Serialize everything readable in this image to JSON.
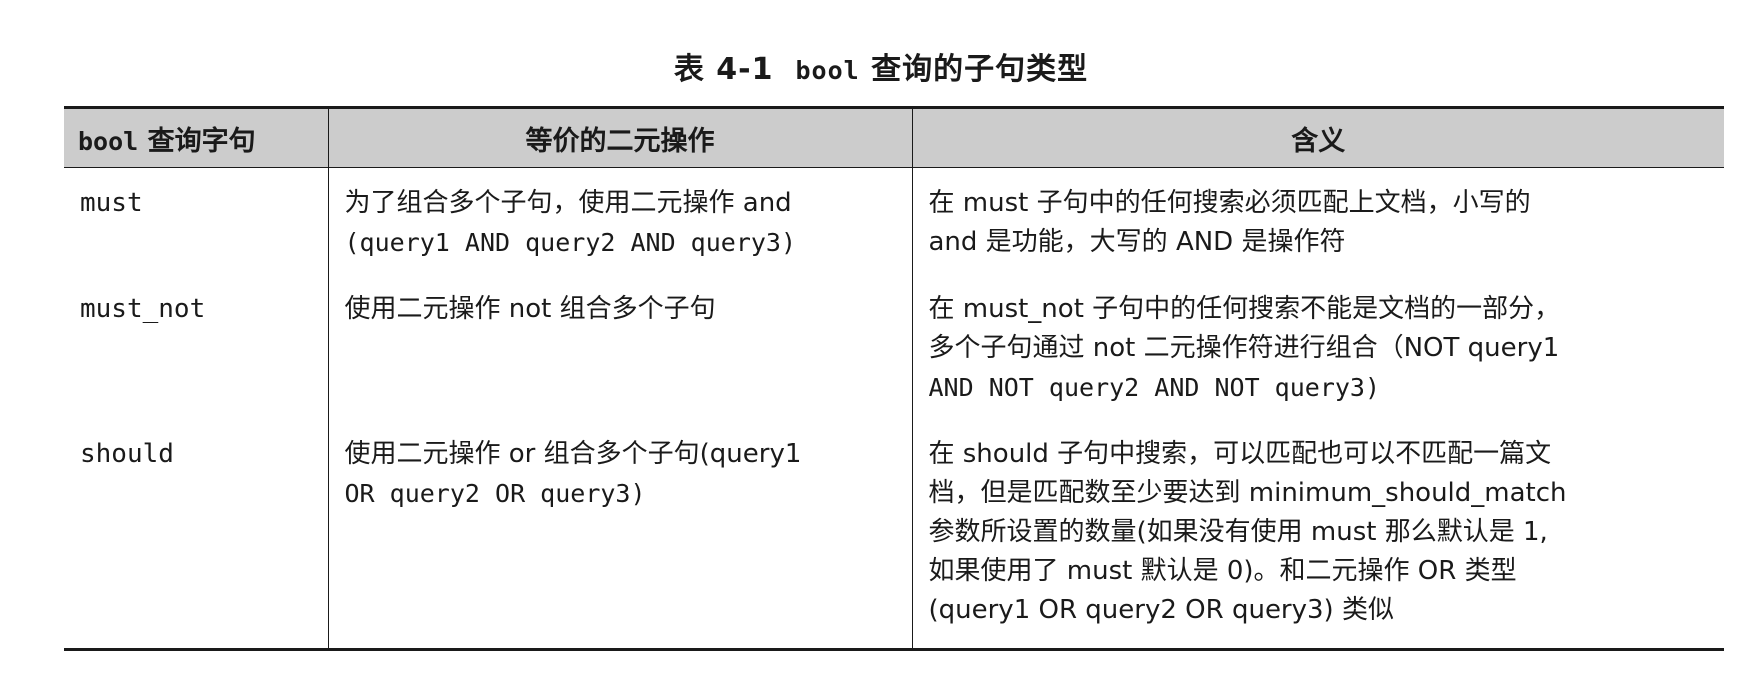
{
  "caption": {
    "number": "表 4-1",
    "keyword": "bool",
    "text": "查询的子句类型"
  },
  "table": {
    "headers": {
      "clause_keyword": "bool",
      "clause_text": "查询字句",
      "equivalent": "等价的二元操作",
      "meaning": "含义"
    },
    "rows": [
      {
        "clause": "must",
        "equivalent_line1": "为了组合多个子句，使用二元操作 and",
        "equivalent_line2": "(query1 AND query2 AND query3)",
        "meaning_line1": "在 must 子句中的任何搜索必须匹配上文档，小写的",
        "meaning_line2": "and 是功能，大写的 AND 是操作符"
      },
      {
        "clause": "must_not",
        "equivalent_line1": "使用二元操作 not 组合多个子句",
        "meaning_line1": "在 must_not 子句中的任何搜索不能是文档的一部分，",
        "meaning_line2": "多个子句通过 not 二元操作符进行组合（NOT query1",
        "meaning_line3": "AND NOT query2 AND NOT query3)"
      },
      {
        "clause": "should",
        "equivalent_line1": "使用二元操作 or 组合多个子句(query1",
        "equivalent_line2": "OR query2 OR query3)",
        "meaning_line1": "在 should 子句中搜索，可以匹配也可以不匹配一篇文",
        "meaning_line2": "档，但是匹配数至少要达到 minimum_should_match",
        "meaning_line3": "参数所设置的数量(如果没有使用 must 那么默认是 1,",
        "meaning_line4": "如果使用了 must 默认是 0)。和二元操作 OR 类型",
        "meaning_line5": "(query1 OR query2 OR query3) 类似"
      }
    ]
  }
}
